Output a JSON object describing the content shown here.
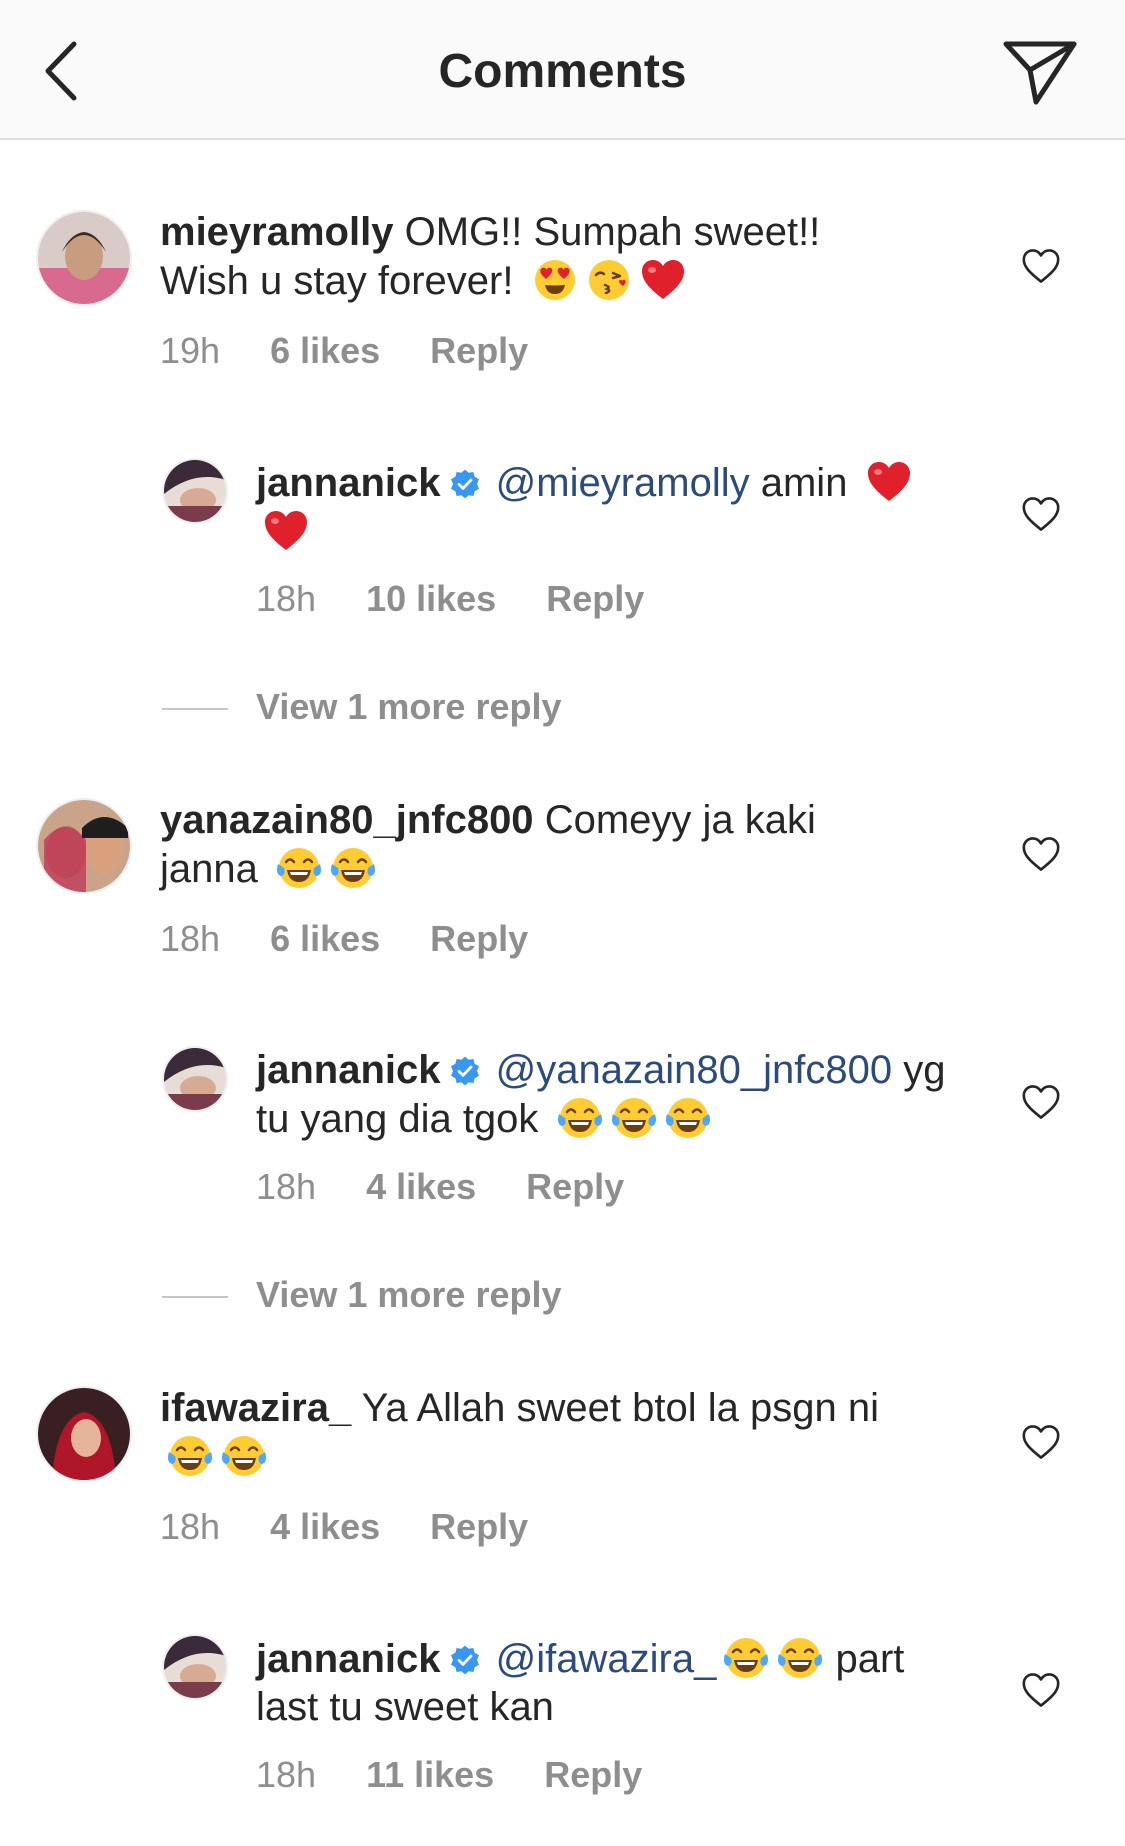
{
  "header": {
    "title": "Comments",
    "back_icon": "chevron-left-icon",
    "send_icon": "paper-plane-icon"
  },
  "comments": [
    {
      "username": "mieyramolly",
      "text": "OMG!! Sumpah sweet!! Wish u stay forever!",
      "emojis": [
        "heart-eyes",
        "kiss-face",
        "red-heart"
      ],
      "time": "19h",
      "likes": "6 likes",
      "reply": "Reply"
    },
    {
      "username": "jannanick",
      "verified": true,
      "mention": "@mieyramolly",
      "text": "amin",
      "emojis": [
        "red-heart",
        "red-heart"
      ],
      "time": "18h",
      "likes": "10 likes",
      "reply": "Reply"
    },
    {
      "username": "yanazain80_jnfc800",
      "text": "Comeyy ja kaki janna",
      "emojis": [
        "tears-of-joy",
        "tears-of-joy"
      ],
      "time": "18h",
      "likes": "6 likes",
      "reply": "Reply"
    },
    {
      "username": "jannanick",
      "verified": true,
      "mention": "@yanazain80_jnfc800",
      "text": "yg tu yang dia tgok",
      "emojis": [
        "tears-of-joy",
        "tears-of-joy",
        "tears-of-joy"
      ],
      "time": "18h",
      "likes": "4 likes",
      "reply": "Reply"
    },
    {
      "username": "ifawazira_",
      "text": "Ya Allah sweet btol la psgn ni",
      "emojis": [
        "tears-of-joy",
        "tears-of-joy"
      ],
      "time": "18h",
      "likes": "4 likes",
      "reply": "Reply"
    },
    {
      "username": "jannanick",
      "verified": true,
      "mention": "@ifawazira_",
      "text": "part last tu sweet kan",
      "emojis": [
        "tears-of-joy",
        "tears-of-joy"
      ],
      "time": "18h",
      "likes": "11 likes",
      "reply": "Reply"
    }
  ],
  "view_more": [
    "View 1 more reply",
    "View 1 more reply"
  ],
  "colors": {
    "text": "#262626",
    "meta": "#8e8e8e",
    "mention": "#2b4a7e",
    "verified": "#3897f0",
    "header_bg": "#fafafa"
  }
}
